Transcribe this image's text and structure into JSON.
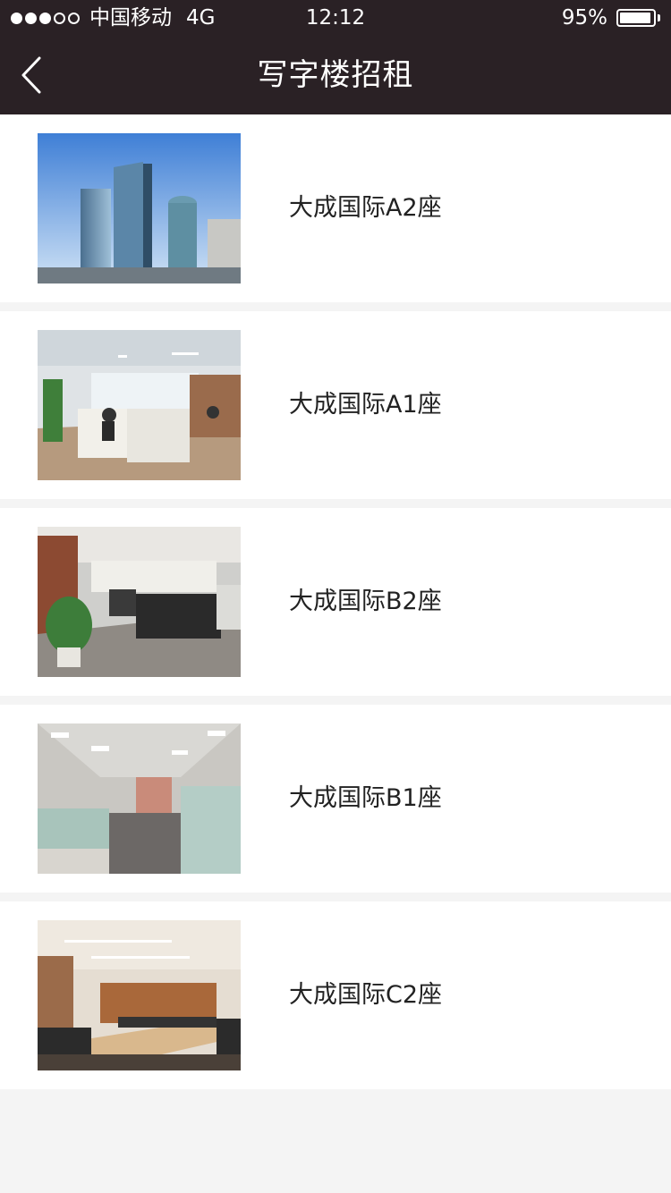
{
  "status_bar": {
    "signal_dots": [
      true,
      true,
      true,
      false,
      false
    ],
    "carrier": "中国移动",
    "network": "4G",
    "time": "12:12",
    "battery_percent_text": "95%",
    "battery_level": 0.95
  },
  "nav": {
    "back_icon": "chevron-left-icon",
    "title": "写字楼招租"
  },
  "colors": {
    "header_bg": "#2a2125",
    "page_bg": "#f4f4f4"
  },
  "listings": [
    {
      "name": "大成国际A2座",
      "image": "skyscraper-photo"
    },
    {
      "name": "大成国际A1座",
      "image": "open-office-photo"
    },
    {
      "name": "大成国际B2座",
      "image": "office-cubicles-photo"
    },
    {
      "name": "大成国际B1座",
      "image": "office-corridor-photo"
    },
    {
      "name": "大成国际C2座",
      "image": "meeting-room-photo"
    }
  ]
}
